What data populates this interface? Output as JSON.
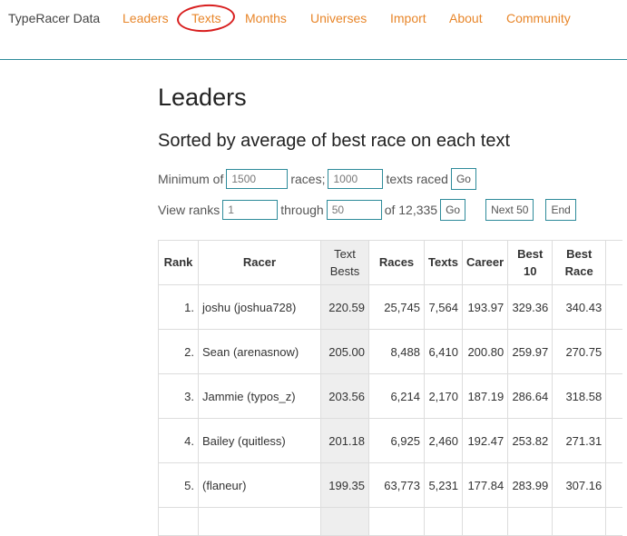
{
  "nav": {
    "brand": "TypeRacer Data",
    "links": [
      "Leaders",
      "Texts",
      "Months",
      "Universes",
      "Import",
      "About",
      "Community"
    ]
  },
  "page": {
    "title": "Leaders",
    "subtitle": "Sorted by average of best race on each text"
  },
  "filters": {
    "min_prefix": "Minimum of",
    "min_races_value": "1500",
    "races_suffix": "races;",
    "min_texts_value": "1000",
    "texts_suffix": "texts raced",
    "go_label": "Go"
  },
  "ranks": {
    "prefix": "View ranks",
    "from_value": "1",
    "through_label": "through",
    "to_value": "50",
    "of_total": "of 12,335",
    "go_label": "Go",
    "next_label": "Next 50",
    "end_label": "End"
  },
  "table": {
    "headers": {
      "rank": "Rank",
      "racer": "Racer",
      "text_bests_1": "Text",
      "text_bests_2": "Bests",
      "races": "Races",
      "texts": "Texts",
      "career": "Career",
      "best10_1": "Best",
      "best10_2": "10",
      "best_race_1": "Best",
      "best_race_2": "Race"
    },
    "rows": [
      {
        "rank": "1.",
        "racer": "joshu (joshua728)",
        "text_bests": "220.59",
        "races": "25,745",
        "texts": "7,564",
        "career": "193.97",
        "best10": "329.36",
        "best_race": "340.43"
      },
      {
        "rank": "2.",
        "racer": "Sean (arenasnow)",
        "text_bests": "205.00",
        "races": "8,488",
        "texts": "6,410",
        "career": "200.80",
        "best10": "259.97",
        "best_race": "270.75"
      },
      {
        "rank": "3.",
        "racer": "Jammie (typos_z)",
        "text_bests": "203.56",
        "races": "6,214",
        "texts": "2,170",
        "career": "187.19",
        "best10": "286.64",
        "best_race": "318.58"
      },
      {
        "rank": "4.",
        "racer": "Bailey (quitless)",
        "text_bests": "201.18",
        "races": "6,925",
        "texts": "2,460",
        "career": "192.47",
        "best10": "253.82",
        "best_race": "271.31"
      },
      {
        "rank": "5.",
        "racer": "(flaneur)",
        "text_bests": "199.35",
        "races": "63,773",
        "texts": "5,231",
        "career": "177.84",
        "best10": "283.99",
        "best_race": "307.16"
      }
    ]
  }
}
